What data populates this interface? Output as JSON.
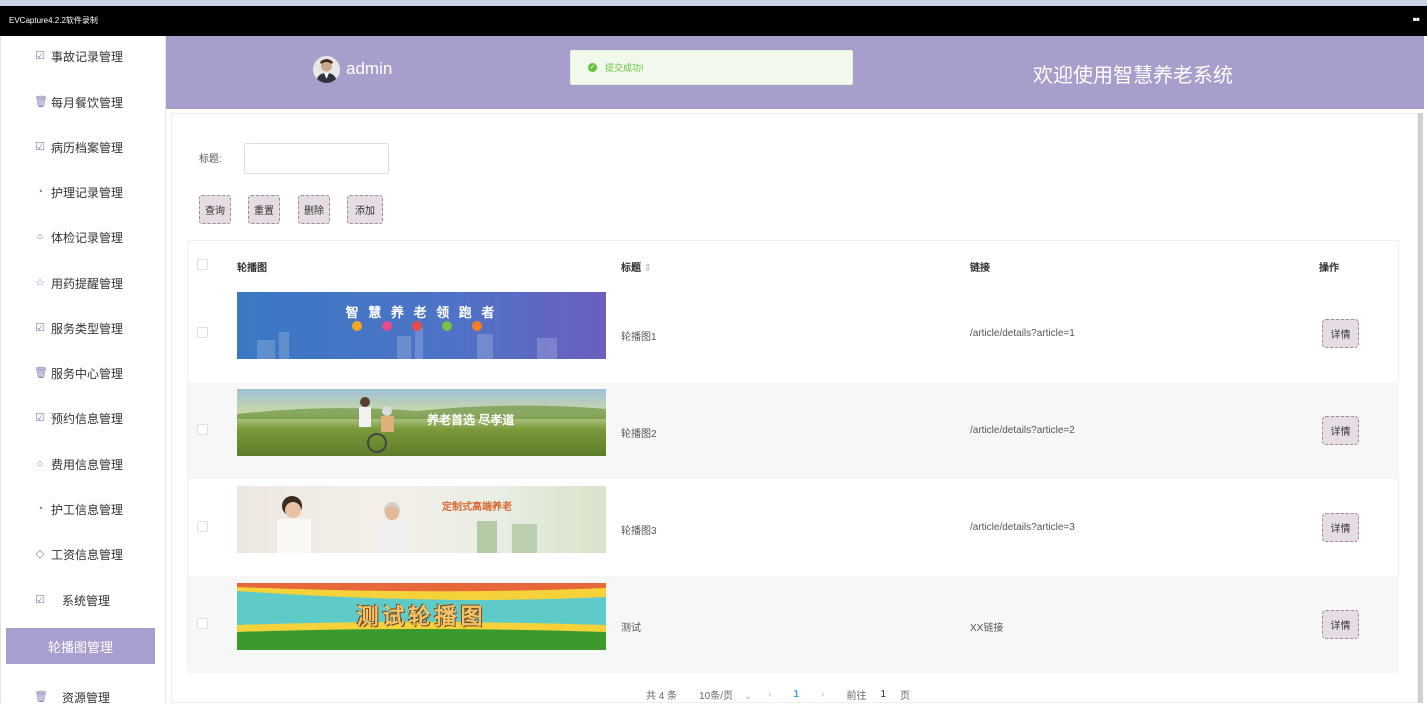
{
  "capture_title": "EVCapture4.2.2软件录制",
  "sidebar": {
    "items": [
      {
        "label": "事故记录管理",
        "icon": "checkbox-icon"
      },
      {
        "label": "每月餐饮管理",
        "icon": "trash-icon"
      },
      {
        "label": "病历档案管理",
        "icon": "checkbox-icon"
      },
      {
        "label": "护理记录管理",
        "icon": "pie-icon"
      },
      {
        "label": "体检记录管理",
        "icon": "drop-icon"
      },
      {
        "label": "用药提醒管理",
        "icon": "star-icon"
      },
      {
        "label": "服务类型管理",
        "icon": "checkbox-icon"
      },
      {
        "label": "服务中心管理",
        "icon": "trash-icon"
      },
      {
        "label": "预约信息管理",
        "icon": "checkbox-icon"
      },
      {
        "label": "费用信息管理",
        "icon": "drop-icon"
      },
      {
        "label": "护工信息管理",
        "icon": "pie-icon"
      },
      {
        "label": "工资信息管理",
        "icon": "diamond-icon"
      },
      {
        "label": "系统管理",
        "icon": "checkbox-icon"
      },
      {
        "label": "资源管理",
        "icon": "trash-icon"
      }
    ],
    "active_label": "轮播图管理"
  },
  "header": {
    "username": "admin",
    "toast": "提交成功!",
    "welcome": "欢迎使用智慧养老系统"
  },
  "search": {
    "label": "标题:",
    "value": "",
    "buttons": {
      "query": "查询",
      "reset": "重置",
      "delete": "删除",
      "add": "添加"
    }
  },
  "table": {
    "columns": {
      "image": "轮播图",
      "title": "标题",
      "link": "链接",
      "action": "操作"
    },
    "rows": [
      {
        "title": "轮播图1",
        "link": "/article/details?article=1",
        "action": "详情",
        "banner_text": "智 慧 养 老 领 跑 者"
      },
      {
        "title": "轮播图2",
        "link": "/article/details?article=2",
        "action": "详情",
        "banner_text": "养老首选  尽孝道"
      },
      {
        "title": "轮播图3",
        "link": "/article/details?article=3",
        "action": "详情",
        "banner_text": "定制式高端养老"
      },
      {
        "title": "测试",
        "link": "XX链接",
        "action": "详情",
        "banner_text": "测试轮播图"
      }
    ]
  },
  "pagination": {
    "total": "共 4 条",
    "page_size": "10条/页",
    "current_page": "1",
    "goto_prefix": "前往",
    "goto_value": "1",
    "goto_suffix": "页"
  }
}
